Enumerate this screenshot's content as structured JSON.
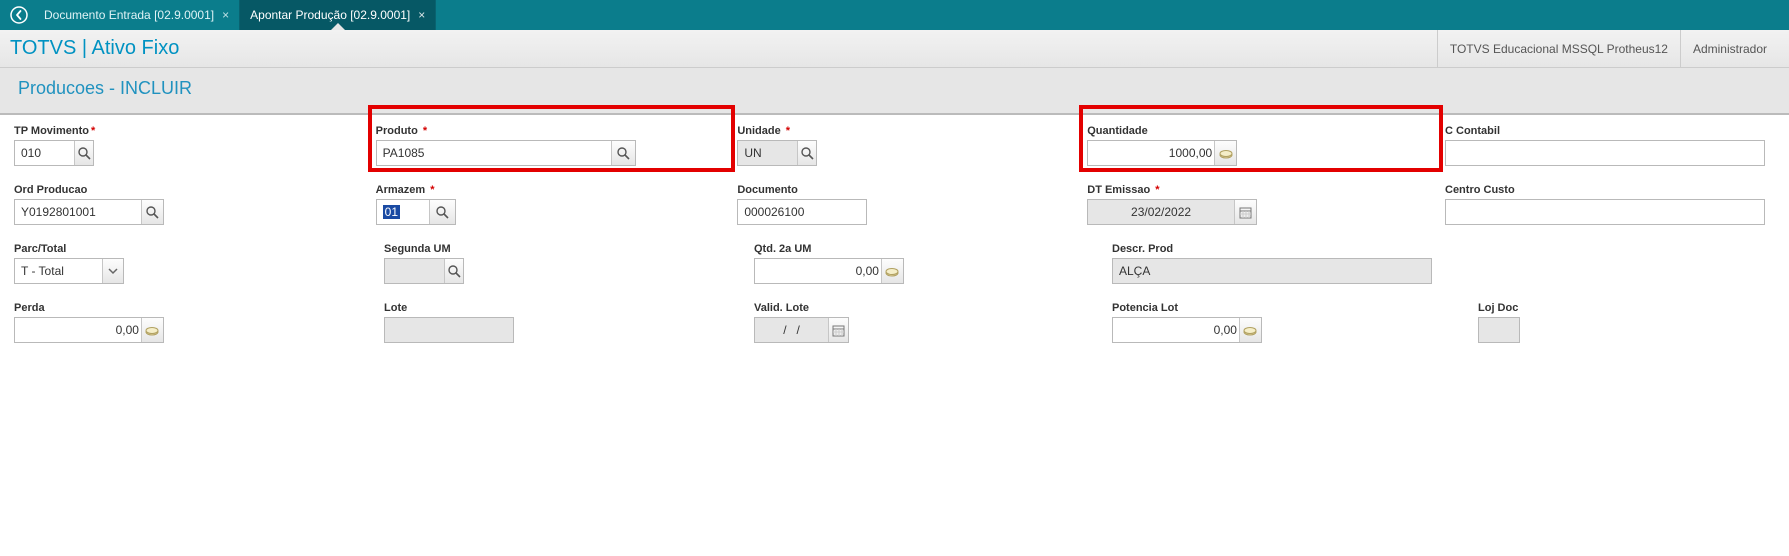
{
  "topbar": {
    "tabs": [
      {
        "label": "Documento Entrada [02.9.0001]"
      },
      {
        "label": "Apontar Produção [02.9.0001]"
      }
    ]
  },
  "subheader": {
    "app": "TOTVS | Ativo Fixo",
    "environment": "TOTVS Educacional MSSQL Protheus12",
    "user": "Administrador"
  },
  "page": {
    "title": "Producoes - INCLUIR"
  },
  "fields": {
    "tp_movimento": {
      "label": "TP Movimento",
      "value": "010"
    },
    "produto": {
      "label": "Produto",
      "value": "PA1085"
    },
    "unidade": {
      "label": "Unidade",
      "value": "UN"
    },
    "quantidade": {
      "label": "Quantidade",
      "value": "1000,00"
    },
    "c_contabil": {
      "label": "C Contabil",
      "value": ""
    },
    "ord_producao": {
      "label": "Ord Producao",
      "value": "Y0192801001"
    },
    "armazem": {
      "label": "Armazem",
      "value": "01"
    },
    "documento": {
      "label": "Documento",
      "value": "000026100"
    },
    "dt_emissao": {
      "label": "DT Emissao",
      "value": "23/02/2022"
    },
    "centro_custo": {
      "label": "Centro Custo",
      "value": ""
    },
    "parc_total": {
      "label": "Parc/Total",
      "value": "T - Total"
    },
    "segunda_um": {
      "label": "Segunda UM",
      "value": ""
    },
    "qtd_2a_um": {
      "label": "Qtd. 2a UM",
      "value": "0,00"
    },
    "descr_prod": {
      "label": "Descr. Prod",
      "value": "ALÇA"
    },
    "perda": {
      "label": "Perda",
      "value": "0,00"
    },
    "lote": {
      "label": "Lote",
      "value": ""
    },
    "valid_lote": {
      "label": "Valid. Lote",
      "value": "/   /"
    },
    "potencia_lot": {
      "label": "Potencia Lot",
      "value": "0,00"
    },
    "loj_doc": {
      "label": "Loj Doc",
      "value": ""
    }
  }
}
